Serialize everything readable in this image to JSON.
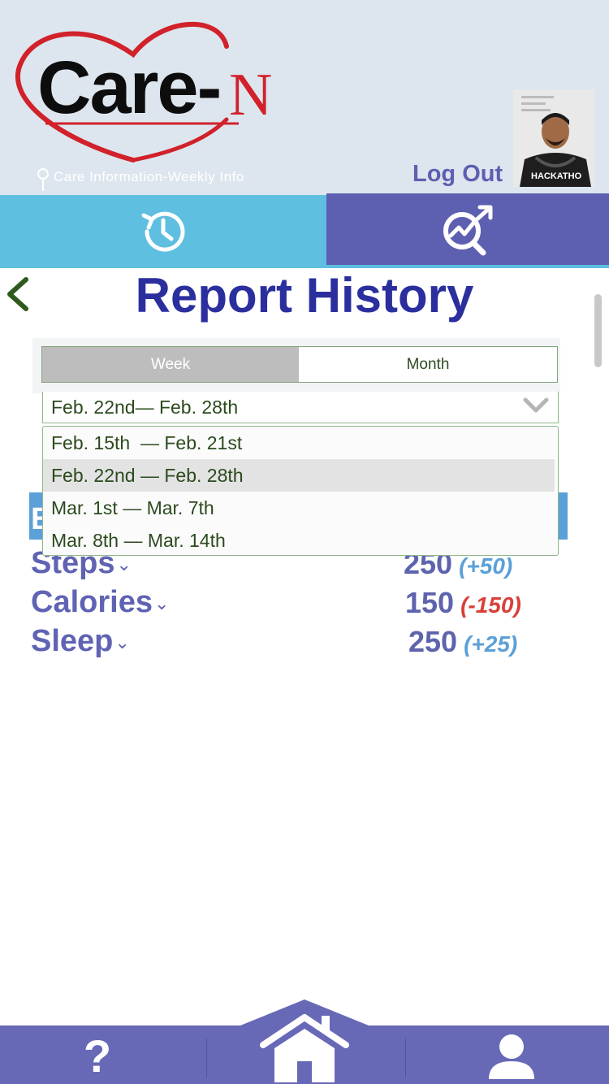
{
  "header": {
    "logo_text": "Care-",
    "logo_n": "N",
    "tagline": "Care Information-Weekly Info",
    "logout_label": "Log Out",
    "avatar_alt": "user-avatar"
  },
  "tabs": [
    {
      "name": "history",
      "icon": "history-icon"
    },
    {
      "name": "analytics",
      "icon": "analytics-icon"
    }
  ],
  "page": {
    "title": "Report History",
    "back_icon": "chevron-left-icon"
  },
  "segment": {
    "week_label": "Week",
    "month_label": "Month",
    "selected": "Week"
  },
  "date_select": {
    "value": "Feb. 22nd— Feb. 28th",
    "options": [
      "Feb. 15th  — Feb. 21st",
      "Feb. 22nd — Feb. 28th",
      "Mar. 1st — Mar. 7th",
      "Mar. 8th — Mar. 14th"
    ],
    "selected_index": 1
  },
  "banner": {
    "letter": "E"
  },
  "metrics": [
    {
      "label": "Steps",
      "value": "250",
      "delta": "(+50)",
      "trend": "up"
    },
    {
      "label": "Calories",
      "value": "150",
      "delta": "(-150)",
      "trend": "down"
    },
    {
      "label": "Sleep",
      "value": "250",
      "delta": "(+25)",
      "trend": "up"
    }
  ],
  "bottom_nav": {
    "help_label": "?",
    "items": [
      "help-icon",
      "home-icon",
      "profile-icon"
    ]
  },
  "colors": {
    "header_bg": "#dde6ee",
    "tab_history": "#5ebfe0",
    "tab_analytics": "#5d5fb0",
    "title": "#2b2f9e",
    "accent_green": "#2e5a1e",
    "delta_up": "#5ba0d8",
    "delta_down": "#d9403a",
    "nav_bg": "#6769b7"
  }
}
